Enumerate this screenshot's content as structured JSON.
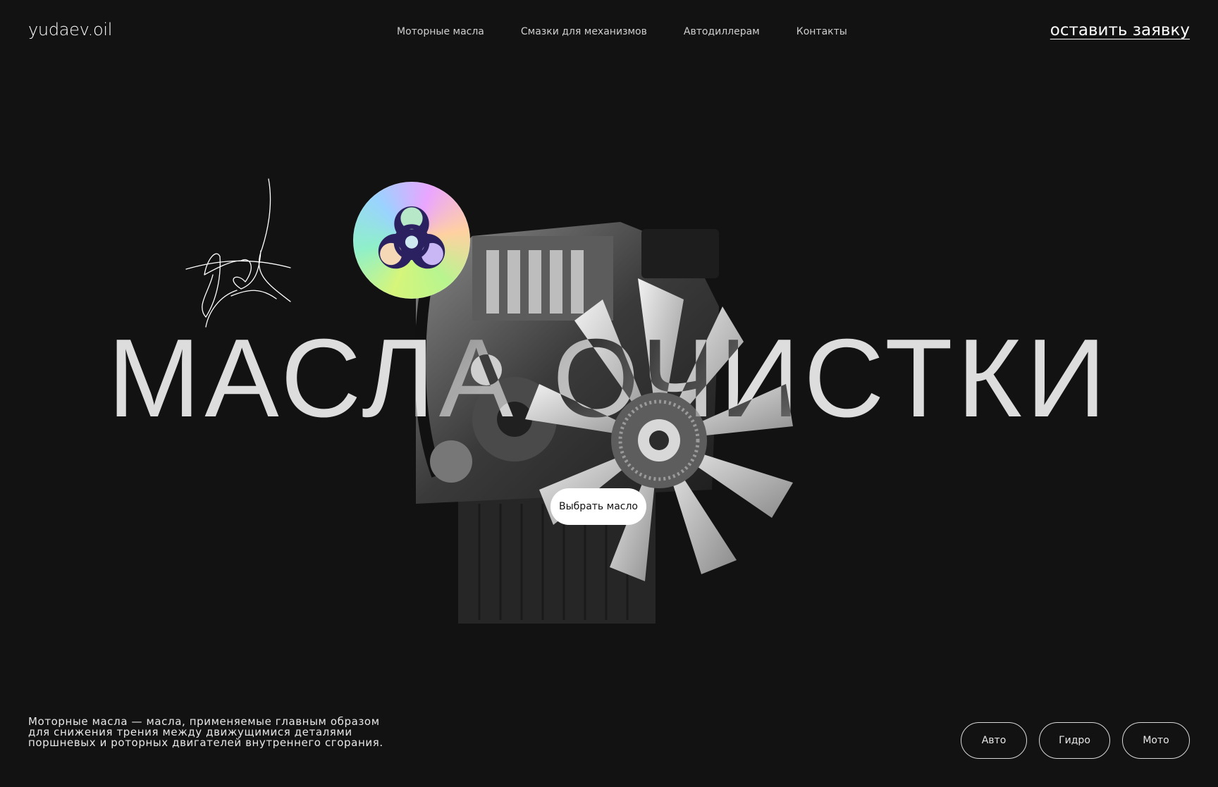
{
  "header": {
    "logo": "yudaev.oil",
    "nav": [
      "Моторные масла",
      "Смазки для механизмов",
      "Автодиллерам",
      "Контакты"
    ],
    "cta": "оставить заявку"
  },
  "hero": {
    "headline": "МАСЛА ОЧИСТКИ",
    "button": "Выбрать масло",
    "badge_icon": "biohazard-icon",
    "image": "engine-image"
  },
  "description": {
    "lines": [
      "Моторные масла — масла, применяемые главным образом",
      "для снижения трения между движущимися деталями",
      "поршневых и роторных двигателей внутреннего сгорания."
    ]
  },
  "categories": [
    "Авто",
    "Гидро",
    "Мото"
  ],
  "colors": {
    "background": "#121212",
    "text": "#ffffff",
    "button_bg": "#ffffff"
  }
}
